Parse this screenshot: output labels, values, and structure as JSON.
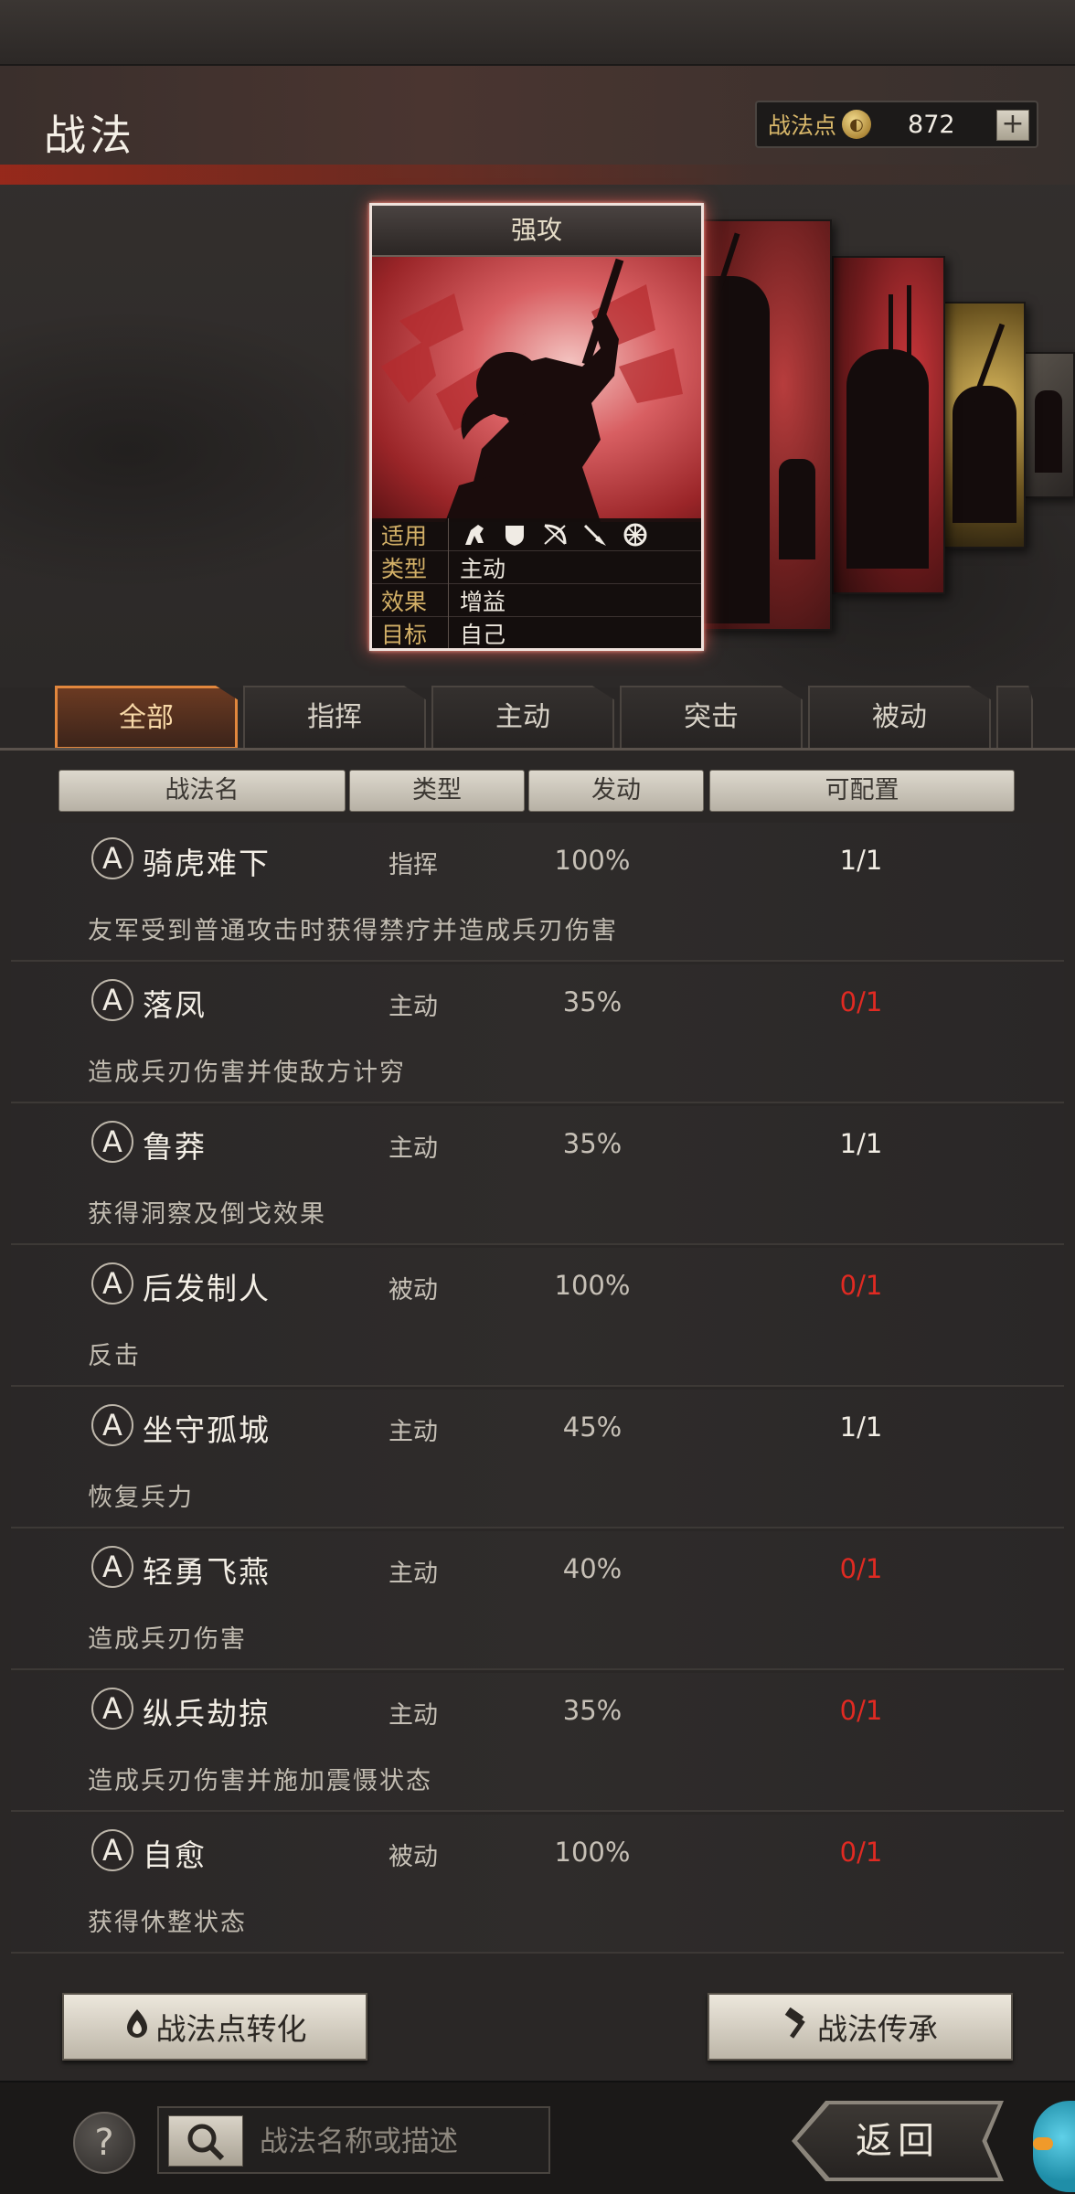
{
  "header": {
    "title": "战法",
    "points_label": "战法点",
    "points_value": "872",
    "plus_label": "+"
  },
  "featured_card": {
    "name": "强攻",
    "info": [
      {
        "key": "适用",
        "icons": [
          "cavalry-icon",
          "shield-icon",
          "bow-icon",
          "spear-icon",
          "siege-wheel-icon"
        ]
      },
      {
        "key": "类型",
        "value": "主动"
      },
      {
        "key": "效果",
        "value": "增益"
      },
      {
        "key": "目标",
        "value": "自己"
      }
    ]
  },
  "tabs": [
    "全部",
    "指挥",
    "主动",
    "突击",
    "被动"
  ],
  "active_tab": 0,
  "table_headers": [
    "战法名",
    "类型",
    "发动",
    "可配置"
  ],
  "rows": [
    {
      "badge": "A",
      "name": "骑虎难下",
      "type": "指挥",
      "rate": "100%",
      "config": "1/1",
      "config_color": "#f2ede4",
      "desc": "友军受到普通攻击时获得禁疗并造成兵刃伤害"
    },
    {
      "badge": "A",
      "name": "落凤",
      "type": "主动",
      "rate": "35%",
      "config": "0/1",
      "config_color": "#e02a22",
      "desc": "造成兵刃伤害并使敌方计穷"
    },
    {
      "badge": "A",
      "name": "鲁莽",
      "type": "主动",
      "rate": "35%",
      "config": "1/1",
      "config_color": "#f2ede4",
      "desc": "获得洞察及倒戈效果"
    },
    {
      "badge": "A",
      "name": "后发制人",
      "type": "被动",
      "rate": "100%",
      "config": "0/1",
      "config_color": "#e02a22",
      "desc": "反击"
    },
    {
      "badge": "A",
      "name": "坐守孤城",
      "type": "主动",
      "rate": "45%",
      "config": "1/1",
      "config_color": "#f2ede4",
      "desc": "恢复兵力"
    },
    {
      "badge": "A",
      "name": "轻勇飞燕",
      "type": "主动",
      "rate": "40%",
      "config": "0/1",
      "config_color": "#e02a22",
      "desc": "造成兵刃伤害"
    },
    {
      "badge": "A",
      "name": "纵兵劫掠",
      "type": "主动",
      "rate": "35%",
      "config": "0/1",
      "config_color": "#e02a22",
      "desc": "造成兵刃伤害并施加震慑状态"
    },
    {
      "badge": "A",
      "name": "自愈",
      "type": "被动",
      "rate": "100%",
      "config": "0/1",
      "config_color": "#e02a22",
      "desc": "获得休整状态"
    }
  ],
  "buttons": {
    "convert": "战法点转化",
    "inherit": "战法传承",
    "back": "返回",
    "help": "?"
  },
  "search": {
    "placeholder": "战法名称或描述"
  }
}
